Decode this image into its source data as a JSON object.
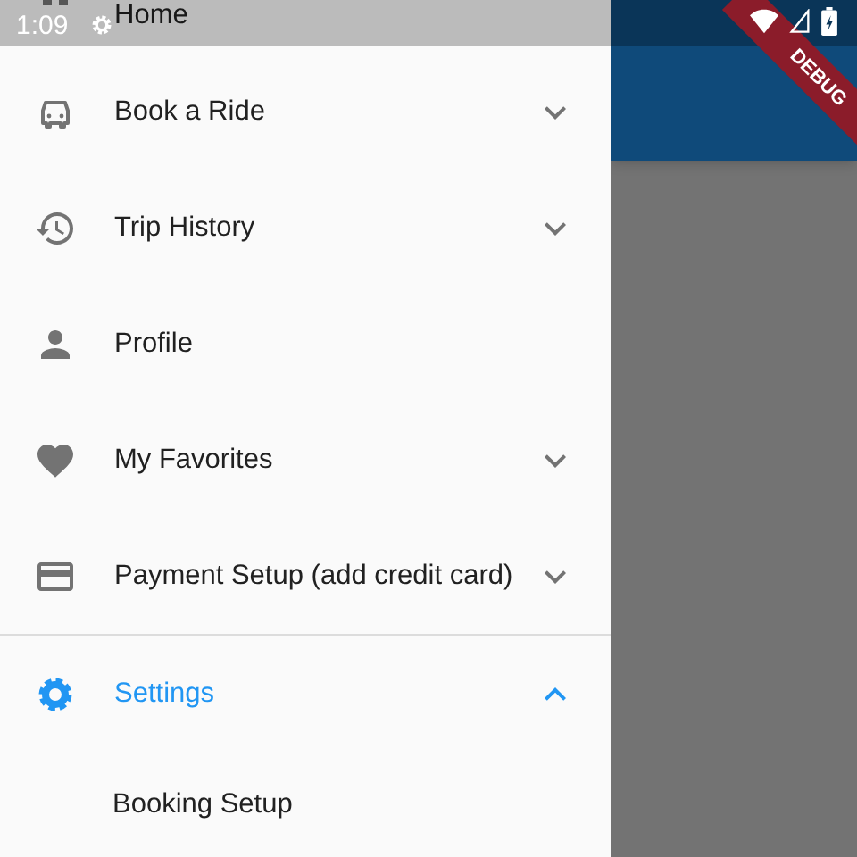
{
  "status_bar": {
    "time": "1:09"
  },
  "debug_banner": "DEBUG",
  "drawer": {
    "items": [
      {
        "label": "Home",
        "kind": "link",
        "selected": false
      },
      {
        "label": "Book a Ride",
        "kind": "expandable",
        "selected": false,
        "expanded": false
      },
      {
        "label": "Trip History",
        "kind": "expandable",
        "selected": false,
        "expanded": false
      },
      {
        "label": "Profile",
        "kind": "link",
        "selected": false
      },
      {
        "label": "My Favorites",
        "kind": "expandable",
        "selected": false,
        "expanded": false
      },
      {
        "label": "Payment Setup (add credit card)",
        "kind": "expandable",
        "selected": false,
        "expanded": false
      },
      {
        "label": "Settings",
        "kind": "expandable",
        "selected": true,
        "expanded": true,
        "children": [
          {
            "label": "Booking Setup"
          }
        ]
      }
    ]
  }
}
